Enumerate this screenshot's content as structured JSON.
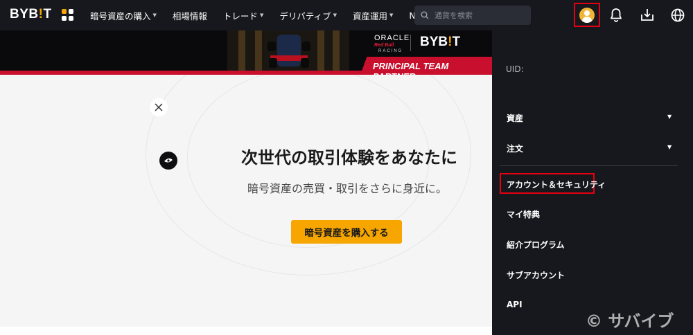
{
  "header": {
    "logo": {
      "pre": "BYB",
      "accent": "!",
      "post": "T"
    },
    "nav": [
      {
        "label": "暗号資産の購入",
        "dropdown": true
      },
      {
        "label": "相場情報",
        "dropdown": false
      },
      {
        "label": "トレード",
        "dropdown": true
      },
      {
        "label": "デリバティブ",
        "dropdown": true
      },
      {
        "label": "資産運用",
        "dropdown": true
      },
      {
        "label": "NFT",
        "dropdown": false
      }
    ],
    "search": {
      "placeholder": "通貨を検索"
    },
    "icons": [
      "apps-icon",
      "search-icon",
      "user-avatar-icon",
      "bell-icon",
      "download-icon",
      "globe-icon"
    ]
  },
  "banner": {
    "sponsor_1": "ORACLE",
    "sponsor_2": "Red Bull",
    "sponsor_3": "RACING",
    "brand": {
      "pre": "BYB",
      "accent": "!",
      "post": "T"
    },
    "partner_text": "PRINCIPAL TEAM PARTNER"
  },
  "hero": {
    "title": "次世代の取引体験をあなたに",
    "subtitle": "暗号資産の売買・取引をさらに身近に。",
    "cta_label": "暗号資産を購入する"
  },
  "account_menu": {
    "uid_label": "UID:",
    "items": [
      {
        "label": "資産",
        "expandable": true
      },
      {
        "label": "注文",
        "expandable": true
      },
      {
        "label": "アカウント＆セキュリティ",
        "expandable": false,
        "highlighted": true
      },
      {
        "label": "マイ特典",
        "expandable": false
      },
      {
        "label": "紹介プログラム",
        "expandable": false
      },
      {
        "label": "サブアカウント",
        "expandable": false
      },
      {
        "label": "API",
        "expandable": false
      }
    ]
  },
  "watermark": "© サバイブ",
  "colors": {
    "accent": "#f7a600",
    "header_bg": "#17181e",
    "highlight_border": "#e60012",
    "banner_red": "#c8102e"
  }
}
